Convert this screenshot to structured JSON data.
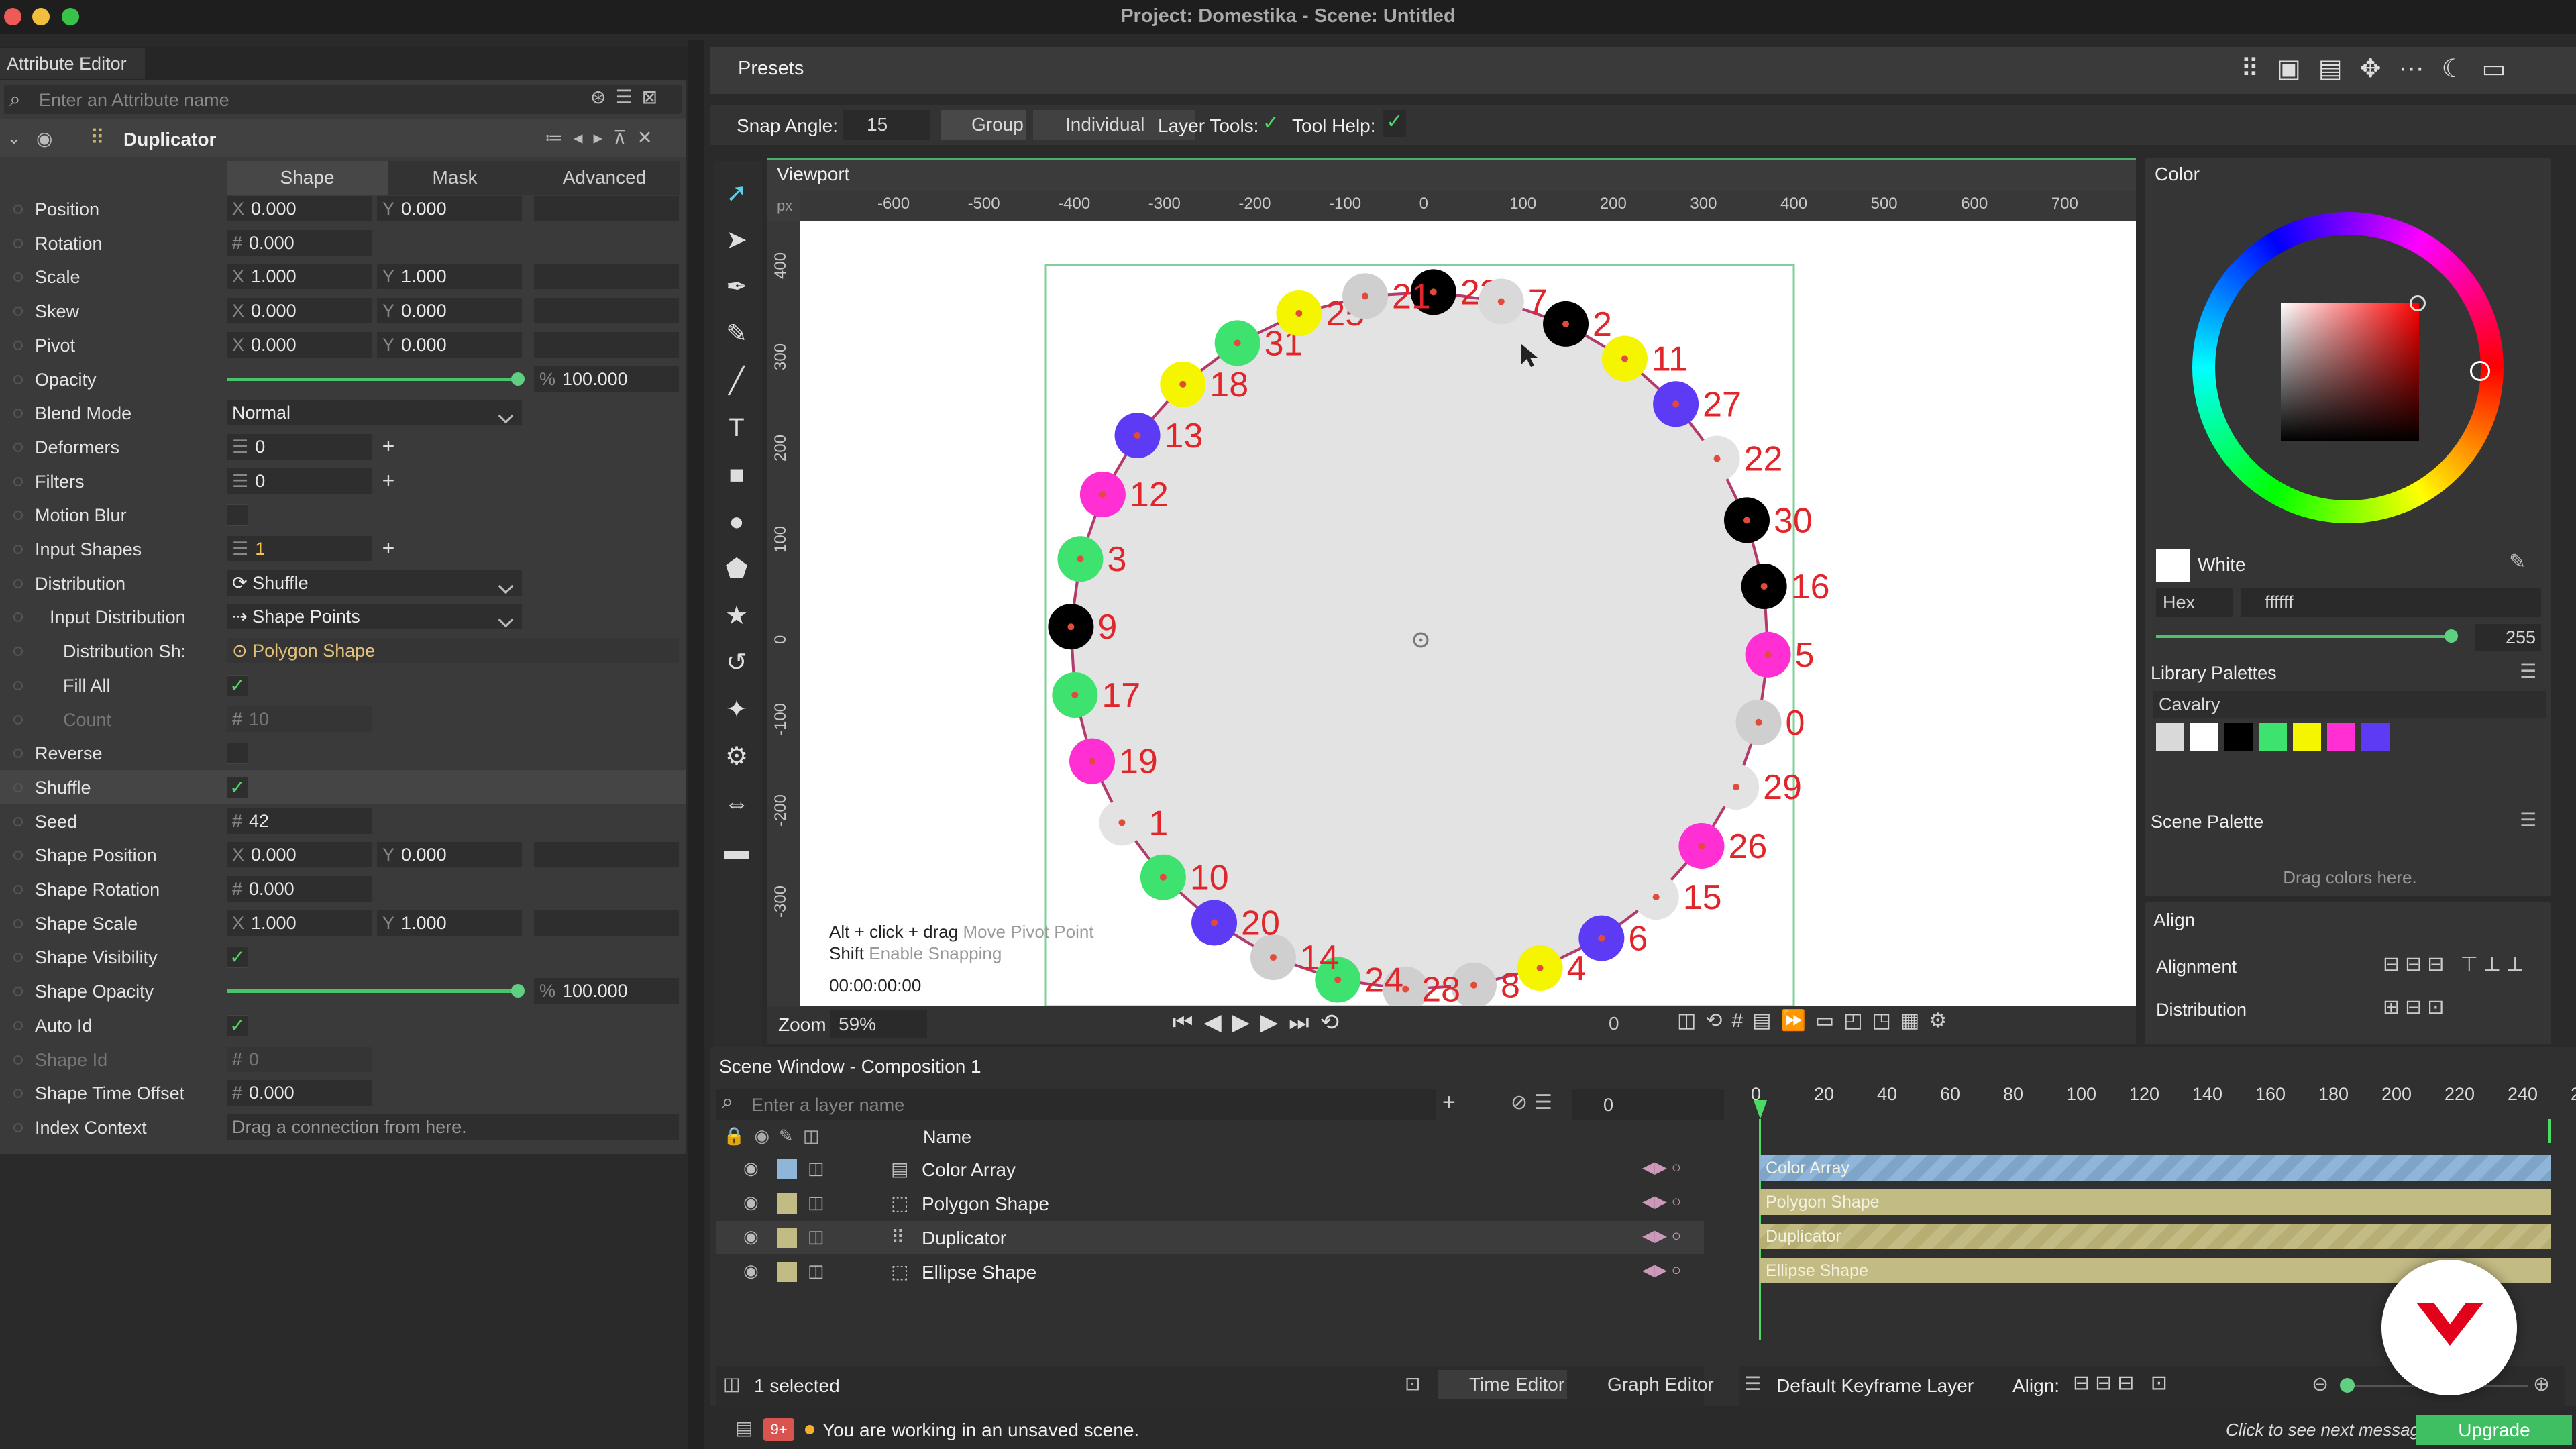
{
  "window": {
    "title": "Project: Domestika - Scene: Untitled"
  },
  "attr": {
    "tab": "Attribute Editor",
    "search_placeholder": "Enter an Attribute name",
    "layer": "Duplicator",
    "tabs": [
      "Shape",
      "Mask",
      "Advanced"
    ],
    "rows": [
      {
        "label": "Position",
        "x": "0.000",
        "y": "0.000"
      },
      {
        "label": "Rotation",
        "v": "0.000"
      },
      {
        "label": "Scale",
        "x": "1.000",
        "y": "1.000"
      },
      {
        "label": "Skew",
        "x": "0.000",
        "y": "0.000"
      },
      {
        "label": "Pivot",
        "x": "0.000",
        "y": "0.000"
      },
      {
        "label": "Opacity",
        "v": "100.000",
        "pct": 100
      },
      {
        "label": "Blend Mode",
        "v": "Normal"
      },
      {
        "label": "Deformers",
        "v": "0"
      },
      {
        "label": "Filters",
        "v": "0"
      },
      {
        "label": "Motion Blur"
      },
      {
        "label": "Input Shapes",
        "v": "1"
      },
      {
        "label": "Distribution",
        "v": "Shuffle"
      },
      {
        "label": "Input Distribution",
        "v": "Shape Points"
      },
      {
        "label": "Distribution Sh:",
        "v": "Polygon Shape"
      },
      {
        "label": "Fill All",
        "checked": true
      },
      {
        "label": "Count",
        "v": "10"
      },
      {
        "label": "Reverse"
      },
      {
        "label": "Shuffle",
        "checked": true
      },
      {
        "label": "Seed",
        "v": "42"
      },
      {
        "label": "Shape Position",
        "x": "0.000",
        "y": "0.000"
      },
      {
        "label": "Shape Rotation",
        "v": "0.000"
      },
      {
        "label": "Shape Scale",
        "x": "1.000",
        "y": "1.000"
      },
      {
        "label": "Shape Visibility",
        "checked": true
      },
      {
        "label": "Shape Opacity",
        "v": "100.000",
        "pct": 100
      },
      {
        "label": "Auto Id",
        "checked": true
      },
      {
        "label": "Shape Id",
        "v": "0"
      },
      {
        "label": "Shape Time Offset",
        "v": "0.000"
      },
      {
        "label": "Index Context",
        "v": "Drag a connection from here."
      }
    ]
  },
  "toolbar": {
    "presets": "Presets",
    "snap_label": "Snap Angle:",
    "snap_value": "15",
    "group": "Group",
    "individual": "Individual",
    "layer_tools": "Layer Tools:",
    "tool_help": "Tool Help:"
  },
  "viewport": {
    "title": "Viewport",
    "unit": "px",
    "ruler_x": [
      "-600",
      "-500",
      "-400",
      "-300",
      "-200",
      "-100",
      "0",
      "100",
      "200",
      "300",
      "400",
      "500",
      "600",
      "700"
    ],
    "ruler_y": [
      "400",
      "300",
      "200",
      "100",
      "0",
      "-100",
      "-200",
      "-300"
    ],
    "hint1_key": "Alt + click + drag",
    "hint1_desc": "Move Pivot Point",
    "hint2_key": "Shift",
    "hint2_desc": "Enable Snapping",
    "timecode": "00:00:00:00",
    "zoom_label": "Zoom",
    "zoom_value": "59%",
    "frame": "0",
    "numbers": [
      "23",
      "7",
      "2",
      "11",
      "27",
      "22",
      "30",
      "16",
      "5",
      "0",
      "29",
      "26",
      "15",
      "6",
      "4",
      "8",
      "28",
      "24",
      "14",
      "20",
      "10",
      "1",
      "19",
      "17",
      "9",
      "3",
      "12",
      "13",
      "18",
      "31",
      "25",
      "21"
    ]
  },
  "color": {
    "title": "Color",
    "name": "White",
    "mode": "Hex",
    "hex": "ffffff",
    "alpha": "255",
    "library_title": "Library Palettes",
    "palette": "Cavalry",
    "swatches": [
      "#d9d9d9",
      "#ffffff",
      "#000000",
      "#3ee36f",
      "#f5f500",
      "#ff2fd3",
      "#5d3bf5"
    ],
    "scene_title": "Scene Palette",
    "scene_hint": "Drag colors here."
  },
  "align": {
    "title": "Align",
    "alignment": "Alignment",
    "distribution": "Distribution"
  },
  "scene": {
    "title": "Scene Window - Composition 1",
    "search_placeholder": "Enter a layer name",
    "frame_field": "0",
    "name_col": "Name",
    "ticks": [
      "0",
      "20",
      "40",
      "60",
      "80",
      "100",
      "120",
      "140",
      "160",
      "180",
      "200",
      "220",
      "240",
      "2"
    ],
    "layers": [
      "Color Array",
      "Polygon Shape",
      "Duplicator",
      "Ellipse Shape"
    ],
    "selected": "1 selected",
    "time_editor": "Time Editor",
    "graph_editor": "Graph Editor",
    "keyframe_layer": "Default Keyframe Layer",
    "align_label": "Align:"
  },
  "status": {
    "badge": "9+",
    "message": "You are working in an unsaved scene.",
    "next": "Click to see next message",
    "upgrade": "Upgrade"
  }
}
